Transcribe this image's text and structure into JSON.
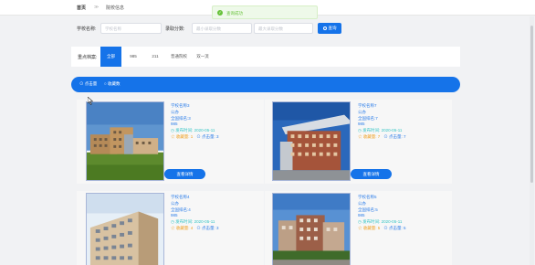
{
  "topbar": {
    "home": "首页",
    "separator": "≫",
    "current": "院校信息"
  },
  "toast": {
    "icon": "check-circle-icon",
    "message": "查询成功"
  },
  "search": {
    "name_label": "学校名称:",
    "name_placeholder": "学校名称",
    "score_label": "录取分数:",
    "min_placeholder": "最小录取分数",
    "max_placeholder": "最大录取分数",
    "button_label": "查询"
  },
  "filter": {
    "label": "重点档案:",
    "tabs": [
      "全部",
      "985",
      "211",
      "普通院校",
      "双一流"
    ],
    "active": "全部"
  },
  "sort_tabs": [
    "⊙ 点击量",
    "○ 收藏数"
  ],
  "cards": [
    {
      "name": "学校名称3",
      "type": "公办",
      "rank": "全国排名:3",
      "tag": "985",
      "time": "◷ 发布时间: 2020-05-11",
      "collect": "☆ 收藏量: 1",
      "clicks": "⊙ 点击量: 3",
      "button": "查看详情"
    },
    {
      "name": "学校名称7",
      "type": "公办",
      "rank": "全国排名:7",
      "tag": "985",
      "time": "◷ 发布时间: 2020-05-11",
      "collect": "☆ 收藏量: 7",
      "clicks": "⊙ 点击量: 7",
      "button": "查看详情"
    },
    {
      "name": "学校名称4",
      "type": "公办",
      "rank": "全国排名:4",
      "tag": "985",
      "time": "◷ 发布时间: 2020-05-11",
      "collect": "☆ 收藏量: 4",
      "clicks": "⊙ 点击量: 3",
      "button": "查看详情"
    },
    {
      "name": "学校名称5",
      "type": "公办",
      "rank": "全国排名:5",
      "tag": "985",
      "time": "◷ 发布时间: 2020-05-11",
      "collect": "☆ 收藏量: 5",
      "clicks": "⊙ 点击量: 5",
      "button": "查看详情"
    }
  ],
  "colors": {
    "primary": "#1573e9",
    "success": "#67c23a",
    "link": "#2b7de9",
    "time": "#35c5c5",
    "collect": "#f0a020"
  }
}
